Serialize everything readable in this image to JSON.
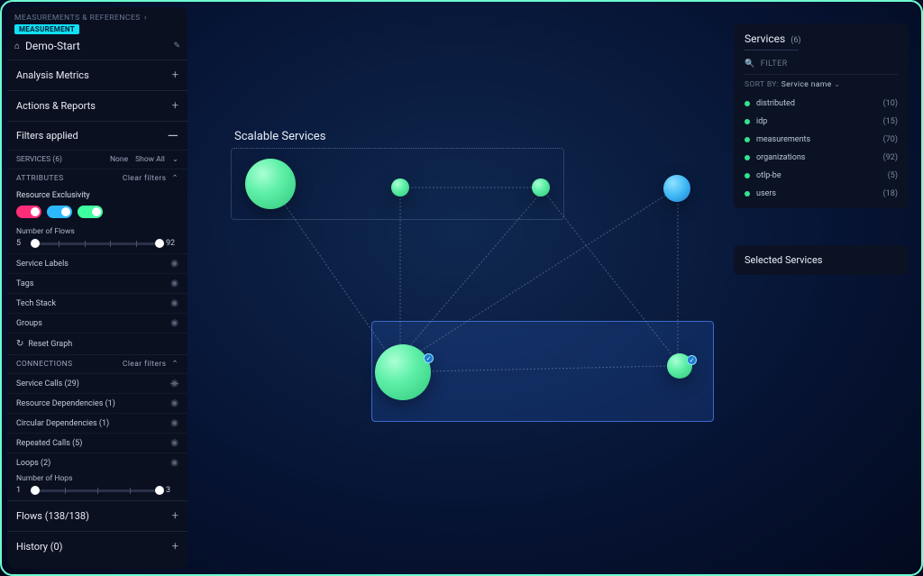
{
  "breadcrumb": "MEASUREMENTS & REFERENCES",
  "badge": "MEASUREMENT",
  "view_title": "Demo-Start",
  "sections": {
    "analysis_metrics": "Analysis Metrics",
    "actions_reports": "Actions & Reports",
    "filters_applied": "Filters applied",
    "flows": "Flows (138/138)",
    "history": "History (0)"
  },
  "services_bar": {
    "label": "SERVICES (6)",
    "none": "None",
    "show_all": "Show All"
  },
  "attributes_bar": {
    "label": "ATTRIBUTES",
    "clear": "Clear filters"
  },
  "resource_exclusivity": "Resource Exclusivity",
  "flows_slider": {
    "label": "Number of Flows",
    "min": "5",
    "max": "92"
  },
  "filter_rows": {
    "service_labels": "Service Labels",
    "tags": "Tags",
    "tech_stack": "Tech Stack",
    "groups": "Groups"
  },
  "reset_graph": "Reset Graph",
  "connections_bar": {
    "label": "CONNECTIONS",
    "clear": "Clear filters"
  },
  "conn_rows": {
    "service_calls": "Service Calls (29)",
    "resource_deps": "Resource Dependencies (1)",
    "circular_deps": "Circular Dependencies (1)",
    "repeated_calls": "Repeated Calls (5)",
    "loops": "Loops (2)"
  },
  "hops_slider": {
    "label": "Number of Hops",
    "min": "1",
    "max": "3"
  },
  "canvas_title": "Scalable Services",
  "right_panel": {
    "title": "Services",
    "count": "(6)",
    "filter": "FILTER",
    "sort_prefix": "SORT BY:",
    "sort_value": "Service name",
    "items": [
      {
        "name": "distributed",
        "count": "(10)"
      },
      {
        "name": "idp",
        "count": "(15)"
      },
      {
        "name": "measurements",
        "count": "(70)"
      },
      {
        "name": "organizations",
        "count": "(92)"
      },
      {
        "name": "otlp-be",
        "count": "(5)"
      },
      {
        "name": "users",
        "count": "(18)"
      }
    ]
  },
  "selected_services": "Selected Services"
}
